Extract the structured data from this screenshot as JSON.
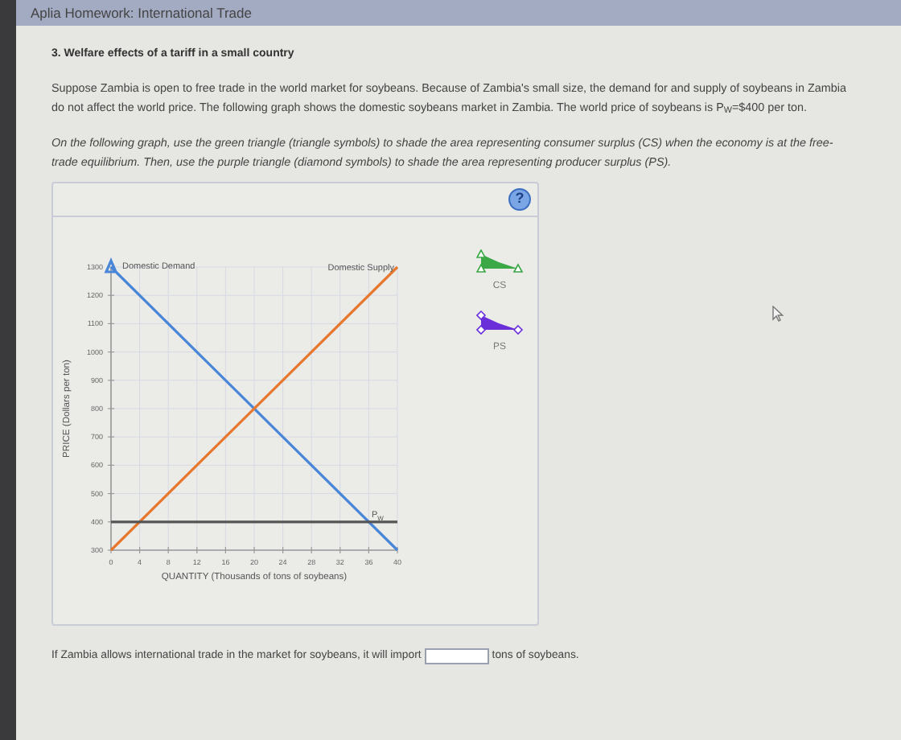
{
  "window": {
    "title": "Aplia Homework: International Trade"
  },
  "question": {
    "title": "3. Welfare effects of a tariff in a small country",
    "paragraph": "Suppose Zambia is open to free trade in the world market for soybeans. Because of Zambia's small size, the demand for and supply of soybeans in Zambia do not affect the world price. The following graph shows the domestic soybeans market in Zambia. The world price of soybeans is P$_{W}$=$400 per ton.",
    "instructions": "On the following graph, use the green triangle (triangle symbols) to shade the area representing consumer surplus (CS) when the economy is at the free-trade equilibrium. Then, use the purple triangle (diamond symbols) to shade the area representing producer surplus (PS)."
  },
  "graph_panel": {
    "help_button": "?",
    "chart_data": {
      "type": "line",
      "xlabel": "QUANTITY (Thousands of tons of soybeans)",
      "ylabel": "PRICE (Dollars per ton)",
      "x": [
        0,
        40
      ],
      "series": [
        {
          "name": "Domestic Demand",
          "color": "#4a86d8",
          "values": [
            1300,
            300
          ]
        },
        {
          "name": "Domestic Supply",
          "color": "#e8772e",
          "values": [
            300,
            1300
          ]
        },
        {
          "name": "P$_{W}$",
          "color": "#555555",
          "values": [
            400,
            400
          ]
        }
      ],
      "grid": true,
      "xlim": [
        0,
        40
      ],
      "ylim": [
        300,
        1300
      ],
      "xticks": [
        0,
        4,
        8,
        12,
        16,
        20,
        24,
        28,
        32,
        36,
        40
      ],
      "yticks": [
        300,
        400,
        500,
        600,
        700,
        800,
        900,
        1000,
        1100,
        1200,
        1300
      ]
    },
    "tools": [
      {
        "label": "CS",
        "color": "#3aa845",
        "kind": "triangle"
      },
      {
        "label": "PS",
        "color": "#6a2fd8",
        "kind": "diamond"
      }
    ]
  },
  "answer": {
    "before": "If Zambia allows international trade in the market for soybeans, it will import",
    "after": "tons of soybeans."
  }
}
